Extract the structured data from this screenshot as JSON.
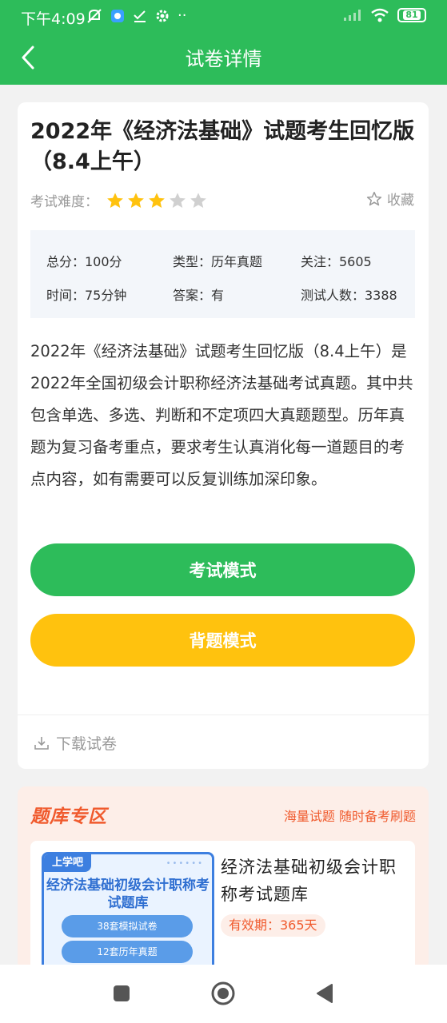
{
  "status_bar": {
    "time": "下午4:09",
    "battery": "81"
  },
  "header": {
    "title": "试卷详情"
  },
  "paper": {
    "title": "2022年《经济法基础》试题考生回忆版（8.4上午）",
    "difficulty_label": "考试难度：",
    "difficulty_stars": 3,
    "difficulty_max": 5,
    "favorite_label": "收藏",
    "info": {
      "total_score": "总分：100分",
      "type": "类型：历年真题",
      "followers": "关注：5605",
      "duration": "时间：75分钟",
      "answer": "答案：有",
      "testers": "测试人数：3388"
    },
    "description": "2022年《经济法基础》试题考生回忆版（8.4上午）是2022年全国初级会计职称经济法基础考试真题。其中共包含单选、多选、判断和不定项四大真题题型。历年真题为复习备考重点，要求考生认真消化每一道题目的考点内容，如有需要可以反复训练加深印象。",
    "exam_mode_label": "考试模式",
    "recite_mode_label": "背题模式",
    "download_label": "下载试卷"
  },
  "question_bank": {
    "title": "题库专区",
    "slogan": "海量试题 随时备考刷题",
    "product": {
      "cover_logo": "上学吧",
      "cover_title": "经济法基础初级会计职称考试题库",
      "cover_pill_1": "38套模拟试卷",
      "cover_pill_2": "12套历年真题",
      "name": "经济法基础初级会计职称考试题库",
      "validity": "有效期：365天"
    }
  },
  "colors": {
    "primary_green": "#2dbc5a",
    "accent_yellow": "#ffc20e",
    "zone_orange": "#f05a2d",
    "star_on": "#ffc20e",
    "star_off": "#d0d0d0"
  },
  "icons": {
    "back": "chevron-left-icon",
    "favorite": "star-outline-icon",
    "download": "download-icon",
    "nav_recent": "square-icon",
    "nav_home": "circle-icon",
    "nav_back": "triangle-back-icon"
  }
}
